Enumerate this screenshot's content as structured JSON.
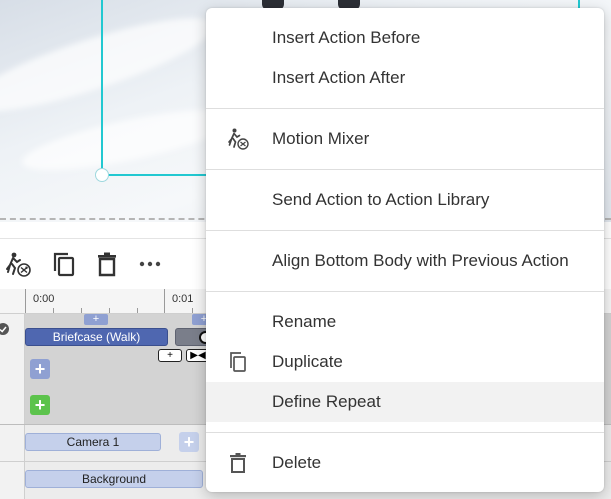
{
  "context_menu": {
    "items": [
      {
        "label": "Insert Action Before",
        "icon": ""
      },
      {
        "label": "Insert Action After",
        "icon": ""
      },
      {
        "label": "Motion Mixer",
        "icon": "motion-mixer-icon"
      },
      {
        "label": "Send Action to Action Library",
        "icon": ""
      },
      {
        "label": "Align Bottom Body with Previous Action",
        "icon": ""
      },
      {
        "label": "Rename",
        "icon": ""
      },
      {
        "label": "Duplicate",
        "icon": "duplicate-icon"
      },
      {
        "label": "Define Repeat",
        "icon": "",
        "hovered": true
      },
      {
        "label": "Delete",
        "icon": "trash-icon"
      }
    ]
  },
  "toolbar": {
    "icons": [
      "motion-mixer-icon",
      "copy-icon",
      "trash-icon",
      "more-icon"
    ]
  },
  "ruler": {
    "labels": [
      "0:00",
      "0:01"
    ]
  },
  "tracks": {
    "actor": {
      "clip_label": "Briefcase (Walk)",
      "add_plus": "+",
      "chip_left": "+",
      "chip_right": "▶◀"
    },
    "camera": {
      "clip_label": "Camera 1",
      "add_plus": "+"
    },
    "background": {
      "clip_label": "Background"
    }
  },
  "colors": {
    "selection": "#22c8d1",
    "clip_primary": "#4f67b0",
    "clip_light": "#c5d0eb",
    "add_green": "#5cc34c",
    "add_blue": "#8fa0d2",
    "menu_hover": "#f2f2f2"
  }
}
